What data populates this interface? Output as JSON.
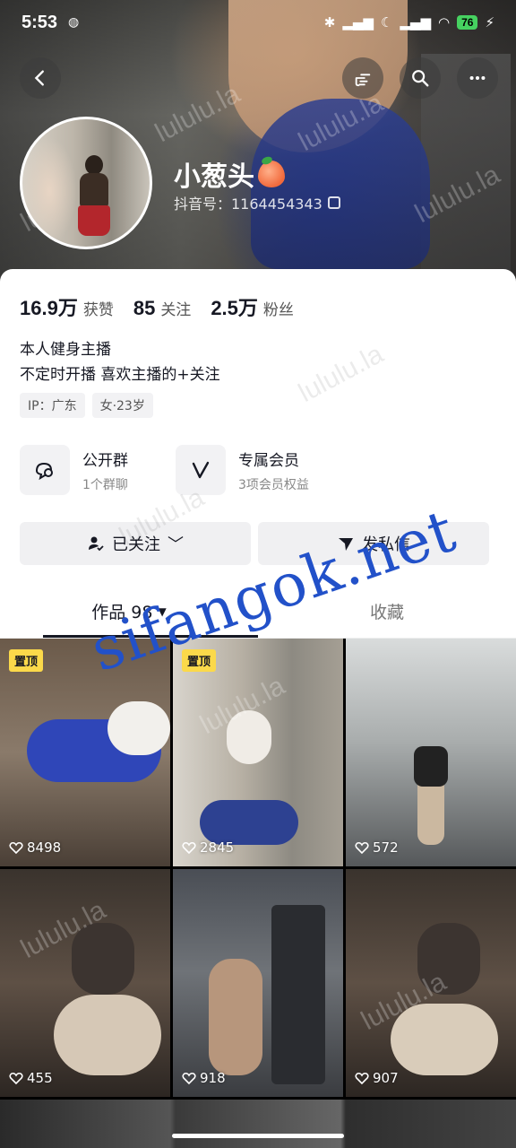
{
  "status_bar": {
    "time": "5:53",
    "battery": "76"
  },
  "colors": {
    "pin_badge": "#fbd94a",
    "watermark": "#2251c9",
    "text_primary": "#161823"
  },
  "header": {
    "back_icon": "chevron-left-icon",
    "gesture_icon": "hand-pointer-icon",
    "search_icon": "search-icon",
    "more_icon": "more-dots-icon"
  },
  "profile": {
    "name": "小葱头",
    "id_label": "抖音号：1164454343",
    "stats": [
      {
        "num": "16.9万",
        "label": "获赞"
      },
      {
        "num": "85",
        "label": "关注"
      },
      {
        "num": "2.5万",
        "label": "粉丝"
      }
    ],
    "bio_lines": [
      "本人健身主播",
      "不定时开播 喜欢主播的+关注"
    ],
    "tags": [
      "IP：广东",
      "女·23岁"
    ]
  },
  "features": [
    {
      "title": "公开群",
      "sub": "1个群聊",
      "icon": "chat-bubble-icon"
    },
    {
      "title": "专属会员",
      "sub": "3项会员权益",
      "icon": "vip-v-icon"
    }
  ],
  "actions": {
    "following": "已关注",
    "message": "发私信"
  },
  "tabs": {
    "works": "作品 98",
    "favorites": "收藏"
  },
  "grid": [
    {
      "pinned": true,
      "pin_label": "置顶",
      "likes": "8498"
    },
    {
      "pinned": true,
      "pin_label": "置顶",
      "likes": "2845"
    },
    {
      "pinned": false,
      "likes": "572"
    },
    {
      "pinned": false,
      "likes": "455"
    },
    {
      "pinned": false,
      "likes": "918"
    },
    {
      "pinned": false,
      "likes": "907"
    }
  ],
  "watermarks": {
    "overlay": "sifangok.net",
    "repeat": "lululu.la"
  }
}
